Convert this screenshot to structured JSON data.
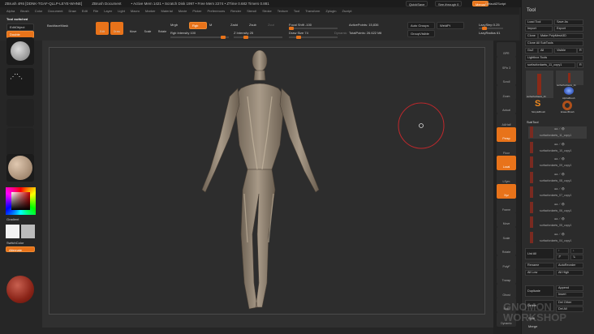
{
  "title_bar": {
    "app": "ZBrush 4R6 [DDNK-TGAF-QLLP-LEYE-WHNE]",
    "doc": "ZBrush Document",
    "stats": "• Active Mem 1421 • Scratch Disk 1997 • Free Mem 2274 • ZTime 0.682 Timers 0.881",
    "quicksave": "QuickSave",
    "seethrough": "See-through 0",
    "menus_btn": "Menus",
    "script": "DefaultZScript"
  },
  "menu": [
    "Alpha",
    "Brush",
    "Color",
    "Document",
    "Draw",
    "Edit",
    "File",
    "Layer",
    "Light",
    "Macro",
    "Marker",
    "Material",
    "Movie",
    "Picker",
    "Preferences",
    "Render",
    "Stencil",
    "Stroke",
    "Texture",
    "Tool",
    "Transform",
    "Zplugin",
    "Zscript"
  ],
  "toolbar": {
    "status": "Tool switched",
    "editobject": "EditObject",
    "double": "Double",
    "backface": "BackfaceMask",
    "edit": "Edit",
    "draw": "Draw",
    "move": "Move",
    "scale": "Scale",
    "rotate": "Rotate",
    "mrgb": "Mrgb",
    "rgb": "Rgb",
    "m": "M",
    "rgb_intensity": "Rgb Intensity 100",
    "zadd": "Zadd",
    "zsub": "Zsub",
    "zcut": "Zcut",
    "z_intensity": "Z Intensity 25",
    "focal": "Focal Shift -100",
    "draw_size": "Draw Size 74",
    "dynamic": "Dynamic",
    "active_points": "ActivePoints: 15,836",
    "total_points": "TotalPoints: 26.622 Mil",
    "auto_groups": "Auto Groups",
    "weld_pt": "WeldPt",
    "group_visible": "GroupVisible",
    "lazy_step": "LazyStep 0.25",
    "lazy_radius": "LazyRadius 61",
    "rgb_intensity_pct": 0.9,
    "z_intensity_pct": 0.25,
    "focal_pct": 0.0,
    "draw_size_pct": 0.2
  },
  "left": {
    "gradient": "Gradient",
    "switchcolor": "SwitchColor",
    "alternate": "Alternate"
  },
  "right_col": [
    "BPR",
    "SPix 3",
    "Scroll",
    "Zoom",
    "Actual",
    "AAHalf",
    "Persp",
    "Floor",
    "Local",
    "LSym",
    "Xyz",
    "Frame",
    "Move",
    "Scale",
    "Rotate",
    "PolyF",
    "Transp",
    "Ghost",
    "Solo",
    "Dynamic"
  ],
  "panel": {
    "title": "Tool",
    "load": "Load Tool",
    "save": "Save As",
    "import": "Import",
    "export": "Export",
    "clone": "Clone",
    "polymesh": "Make PolyMesh3D",
    "clone_all": "Clone All SubTools",
    "goz": "GoZ",
    "all": "All",
    "visible": "Visible",
    "r": "R",
    "lightbox": "Lightbox Tools",
    "current_tool": "surfacfordaets_11_copy1",
    "current_count": "R",
    "tools": [
      "surfacfordaets_11",
      "surfacfordaets_11",
      "AlphaBrush",
      "SimpleBrush",
      "EraserBrush"
    ],
    "subtool_title": "SubTool",
    "subtools": [
      "surfacfordaets_11_copy1",
      "surfacfordaets_10_copy1",
      "surfacfordaets_09_copy1",
      "surfacfordaets_08_copy1",
      "surfacfordaets_07_copy1",
      "surfacfordaets_06_copy1",
      "surfacfordaets_05_copy1",
      "surfacfordaets_04_copy1"
    ],
    "list_all": "List All",
    "rename": "Rename",
    "autoreorder": "AutoReorder",
    "all_low": "All Low",
    "all_high": "All High",
    "duplicate": "Duplicate",
    "append": "Append",
    "insert": "Insert",
    "delete": "Delete",
    "del_other": "Del Other",
    "del_all": "Del All",
    "split": "Split",
    "merge": "Merge"
  },
  "watermark": "GNOMON WORKSHOP",
  "colors": {
    "accent": "#e8731a",
    "brush_circle": "#c0282c"
  }
}
